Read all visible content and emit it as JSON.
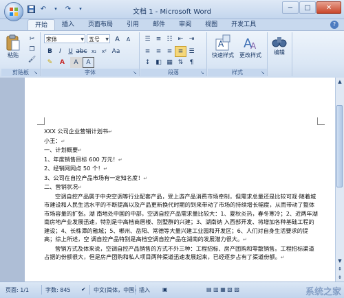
{
  "window": {
    "title": "文档 1 - Microsoft Word",
    "controls": [
      "−",
      "□",
      "✕"
    ]
  },
  "quick_access": [
    "save-icon",
    "undo-icon",
    "redo-icon",
    "customize-icon"
  ],
  "tabs": [
    "开始",
    "插入",
    "页面布局",
    "引用",
    "邮件",
    "审阅",
    "视图",
    "开发工具"
  ],
  "ribbon": {
    "clipboard": {
      "paste": "粘贴",
      "label": "剪贴板"
    },
    "font": {
      "name": "宋体",
      "size": "五号",
      "label": "字体"
    },
    "paragraph": {
      "label": "段落"
    },
    "styles": {
      "quick": "快速样式",
      "change": "更改样式",
      "label": "样式"
    },
    "editing": {
      "label": "编辑"
    }
  },
  "document": {
    "lines": [
      "XXX 公司企业营销计划书",
      "小王：",
      "一、计划概要",
      "1、年度销售目标 600 万元！",
      "2、经销网网点 50 个！",
      "3、公司在自控产品市场有一定知名度！",
      "二、营销状况"
    ],
    "paragraph1": "空调自控产品属于中央空调等行业配套产品，受上游产品消费市场牵制，但需求总量还是比较可观·随着城市建设和人民生活水平的不断提高以及产品更新换代时期的到来带动了市场的持续增长幅度，从而带动了整体市场容量的扩张。湖 南地处中国的中部，空调自控产品需求量比较大：1、夏秋炎热，春冬寒冷；2、近两年湖南房地产业发展迅速，特别是中高档商居楼、别墅群的兴建；3、湖南纳 入西部开发、将增加各种基础工程的建设；4、长株潭的融城；5、郴州、岳阳、常德等大量兴建工业园和开发区；6、人们对自身生活要求的提高；综上所述，空 调自控产品特别是高档空调自控产品在湖南的发展潜力很大。",
    "paragraph2": "营销方式及体来说，空调自控产品销售的方式不外三种：工程招标、房产团购和零散销售。工程招标渠道占据的份额很大，但是房产团购和私人项目两种渠道迅速发展起来，已经逐步占有了渠道份额。"
  },
  "status": {
    "page": "页面: 1/1",
    "words": "字数: 845",
    "language": "中文(简体，中国)",
    "mode": "插入"
  },
  "watermark": "系统之家"
}
